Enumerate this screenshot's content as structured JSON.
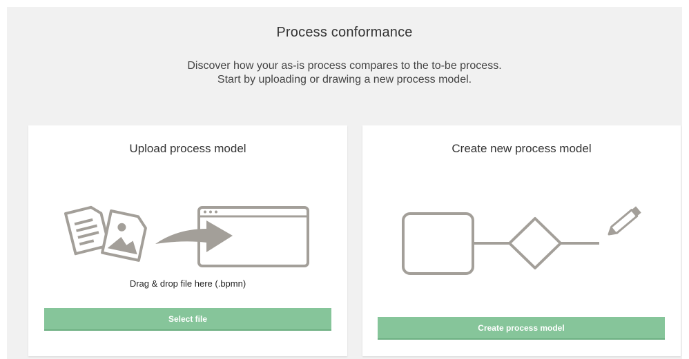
{
  "header": {
    "title": "Process conformance",
    "subtitle_line1": "Discover how your as-is process compares to the to-be process.",
    "subtitle_line2": "Start by uploading or drawing a new process model."
  },
  "upload_card": {
    "title": "Upload process model",
    "drop_text": "Drag & drop file here (.bpmn)",
    "button_label": "Select file",
    "icons": [
      "document-icon",
      "image-file-icon",
      "arrow-icon",
      "browser-window-icon"
    ]
  },
  "create_card": {
    "title": "Create new process model",
    "button_label": "Create process model",
    "icons": [
      "task-box-icon",
      "gateway-diamond-icon",
      "pencil-icon"
    ]
  },
  "colors": {
    "background_panel": "#f1f1f1",
    "card": "#ffffff",
    "button": "#86c59a",
    "illustration": "#a39f99"
  }
}
